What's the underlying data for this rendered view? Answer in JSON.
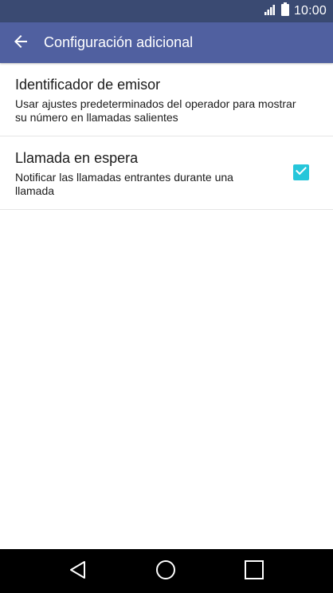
{
  "status_bar": {
    "time": "10:00",
    "icons": [
      "signal-icon",
      "battery-icon"
    ],
    "background": "#3a4a72"
  },
  "app_bar": {
    "title": "Configuración adicional",
    "back_icon": "arrow-left-icon",
    "background": "#5060a0"
  },
  "settings": {
    "items": [
      {
        "title": "Identificador de emisor",
        "summary": "Usar ajustes predeterminados del operador para mostrar su número en llamadas salientes"
      },
      {
        "title": "Llamada en espera",
        "summary": "Notificar las llamadas entrantes durante una llamada",
        "checkbox": {
          "checked": true,
          "color": "#26c6da"
        }
      }
    ]
  },
  "nav_bar": {
    "buttons": [
      "back-triangle-icon",
      "home-circle-icon",
      "recents-square-icon"
    ],
    "background": "#000000"
  }
}
